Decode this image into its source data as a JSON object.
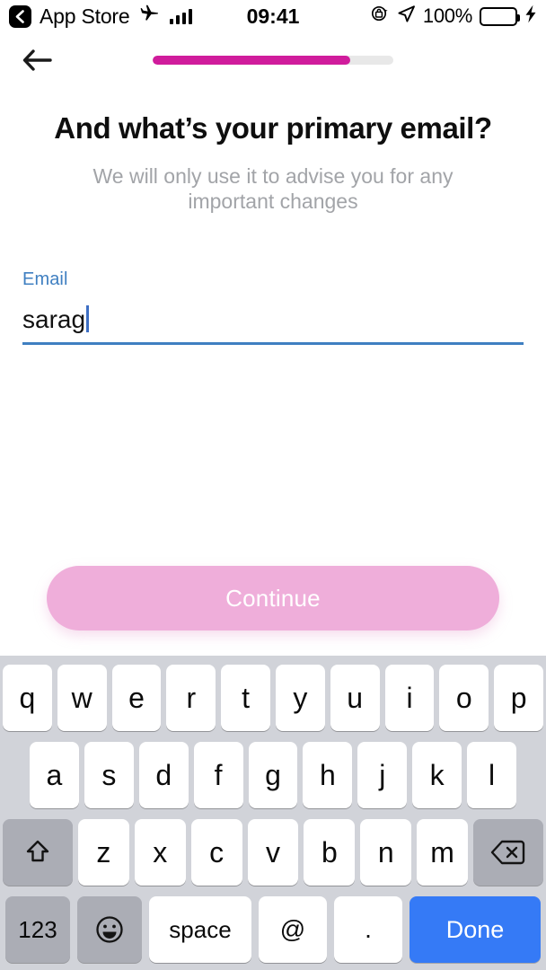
{
  "status_bar": {
    "back_label": "App Store",
    "time": "09:41",
    "battery_percent": "100%",
    "icons": {
      "back": "back-chevron-icon",
      "airplane": "airplane-mode-icon",
      "signal": "signal-bars-icon",
      "rotation_lock": "rotation-lock-icon",
      "location": "location-arrow-icon",
      "battery": "battery-icon",
      "charging": "charging-bolt-icon"
    },
    "battery_color": "#FCD734"
  },
  "nav": {
    "back_icon": "back-arrow-icon",
    "progress_percent": 82,
    "progress_fill_color": "#D01C9C",
    "progress_track_color": "#E8E8E8"
  },
  "content": {
    "headline": "And what’s your primary email?",
    "subtitle": "We will only use it to advise you for any important changes"
  },
  "email_field": {
    "label": "Email",
    "value": "sarag",
    "placeholder": "Email",
    "accent_color": "#3F7FC1"
  },
  "primary_action": {
    "label": "Continue",
    "background_color": "#EFAEDA",
    "text_color": "#FFFFFF"
  },
  "keyboard": {
    "background_color": "#D1D3D9",
    "row1": [
      "q",
      "w",
      "e",
      "r",
      "t",
      "y",
      "u",
      "i",
      "o",
      "p"
    ],
    "row2": [
      "a",
      "s",
      "d",
      "f",
      "g",
      "h",
      "j",
      "k",
      "l"
    ],
    "row3_letters": [
      "z",
      "x",
      "c",
      "v",
      "b",
      "n",
      "m"
    ],
    "shift_icon": "shift-arrow-icon",
    "backspace_icon": "backspace-delete-icon",
    "numbers_key": "123",
    "emoji_icon": "emoji-smiley-icon",
    "space_key": "space",
    "at_key": "@",
    "dot_key": ".",
    "done_key": "Done",
    "done_color": "#357AF6"
  }
}
